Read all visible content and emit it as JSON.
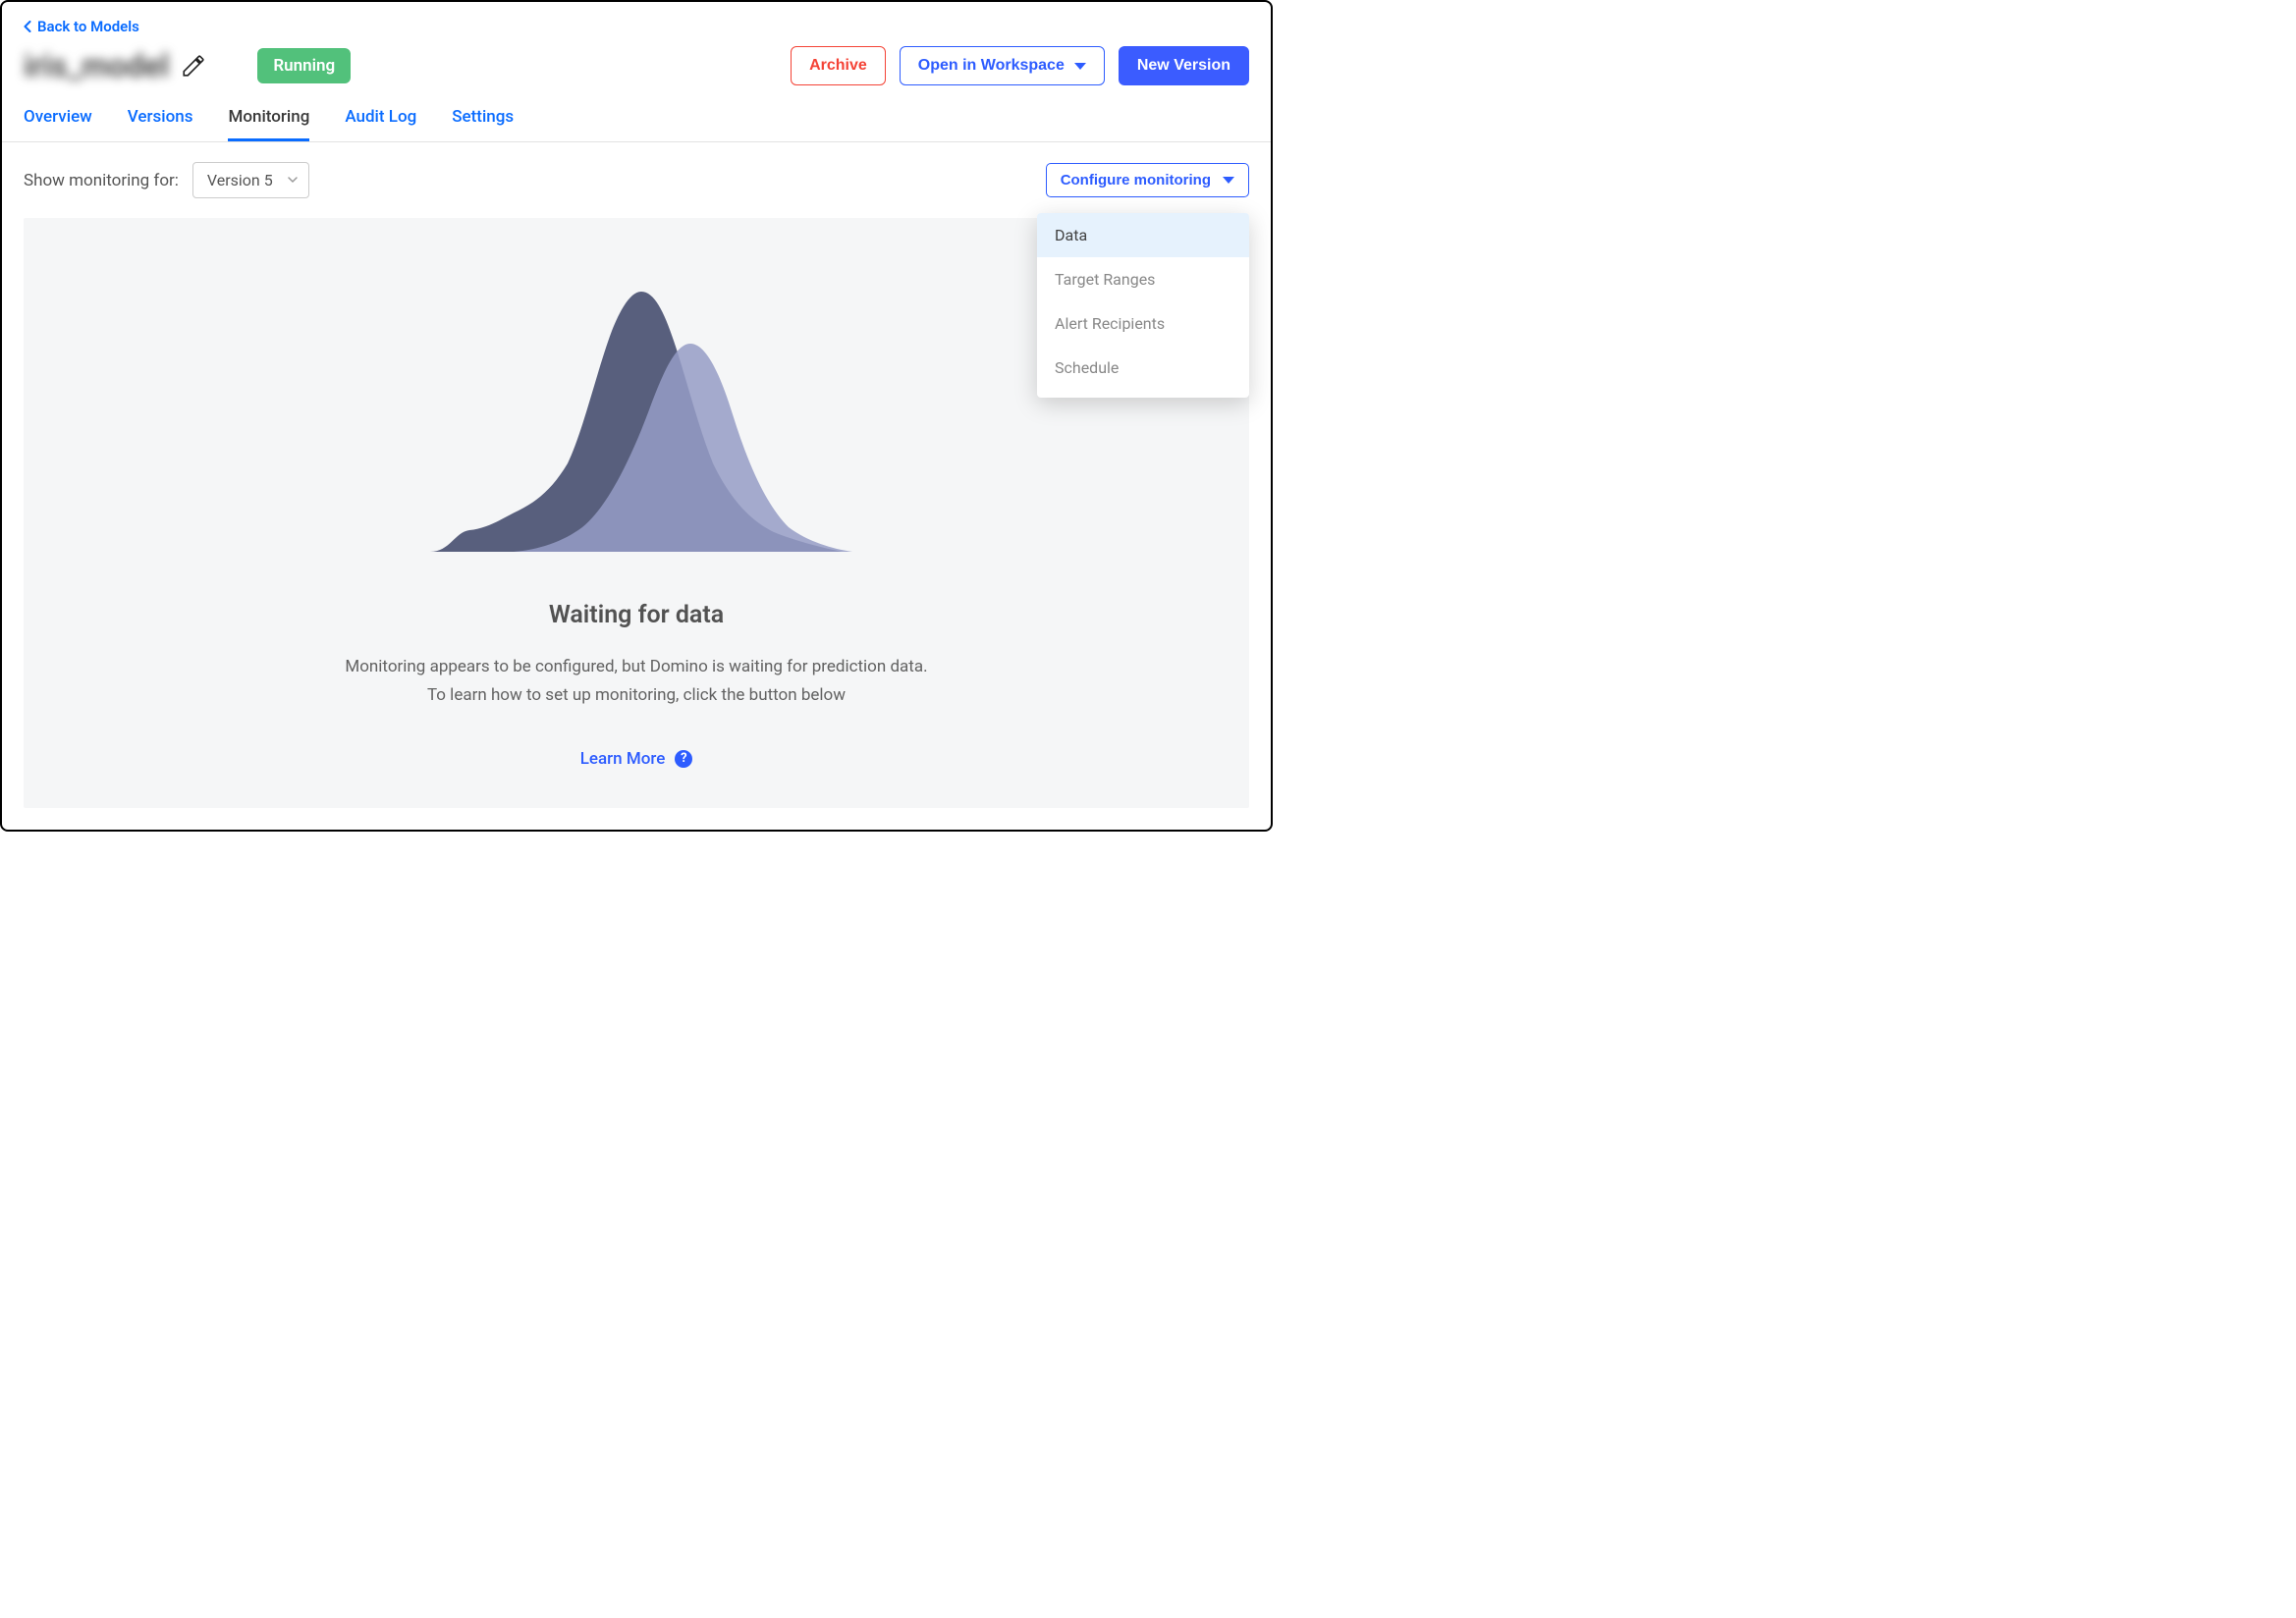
{
  "nav": {
    "back": "Back to Models"
  },
  "header": {
    "title": "iris_model",
    "status": "Running",
    "archive": "Archive",
    "open_workspace": "Open in Workspace",
    "new_version": "New Version"
  },
  "tabs": {
    "overview": "Overview",
    "versions": "Versions",
    "monitoring": "Monitoring",
    "audit": "Audit Log",
    "settings": "Settings"
  },
  "controls": {
    "show_label": "Show monitoring for:",
    "version_selected": "Version 5",
    "configure": "Configure monitoring"
  },
  "dropdown": {
    "data": "Data",
    "target_ranges": "Target Ranges",
    "alert_recipients": "Alert Recipients",
    "schedule": "Schedule"
  },
  "empty": {
    "title": "Waiting for data",
    "line1": "Monitoring appears to be configured, but Domino is waiting for prediction data.",
    "line2": "To learn how to set up monitoring, click the button below",
    "learn_more": "Learn More",
    "help": "?"
  }
}
